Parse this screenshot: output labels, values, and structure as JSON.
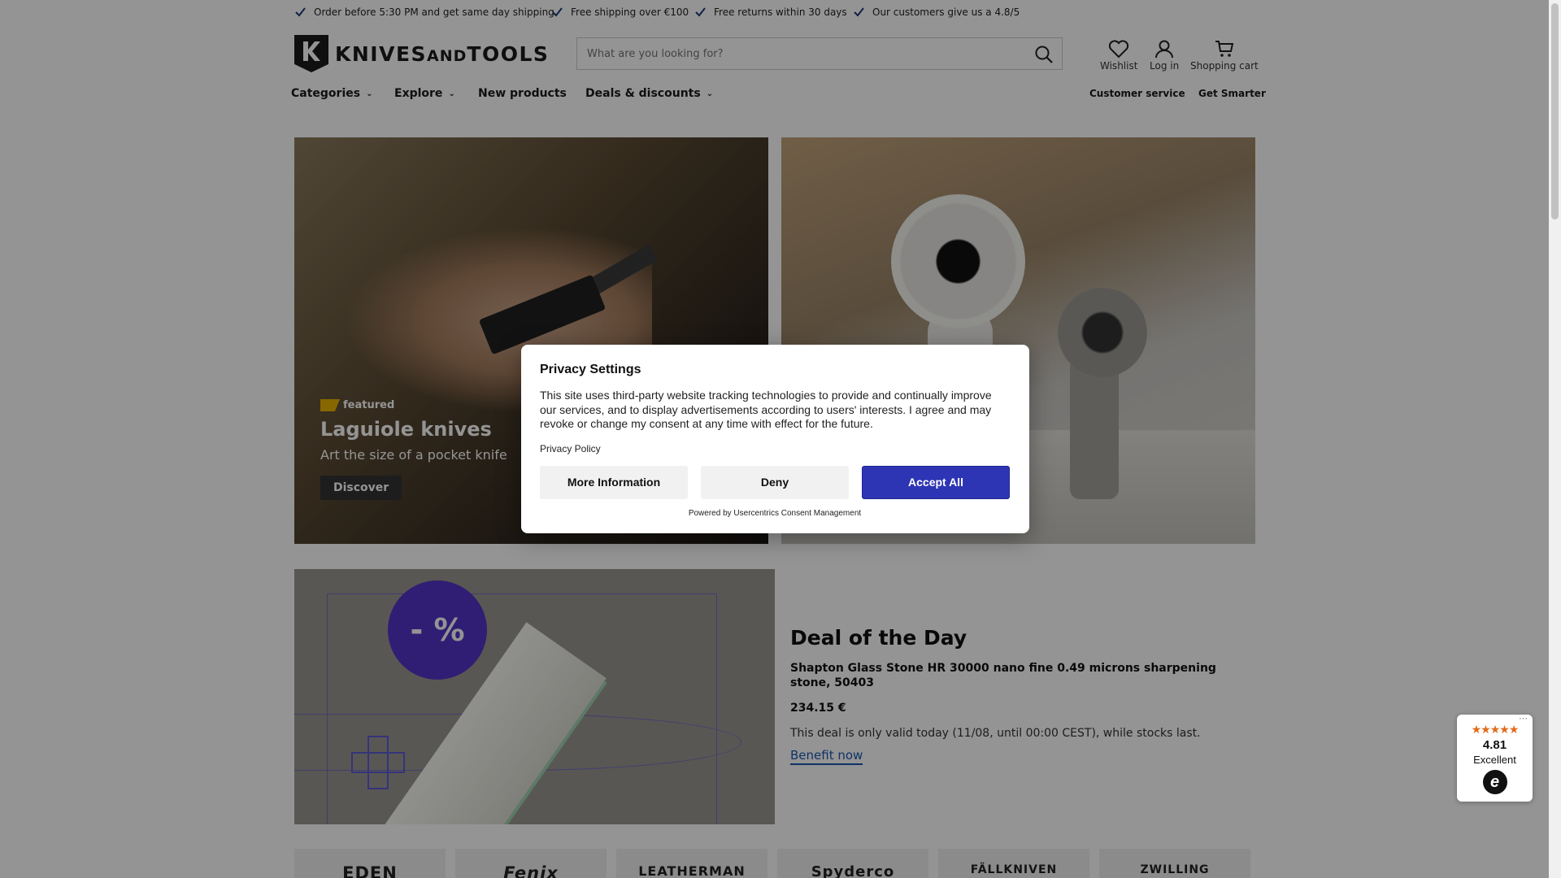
{
  "usp": [
    "Order before 5:30 PM and get same day shipping",
    "Free shipping over €100",
    "Free returns within 30 days",
    "Our customers give us a 4.8/5"
  ],
  "logo": {
    "text_main": "KNIVES",
    "text_and": "AND",
    "text_end": "TOOLS"
  },
  "search": {
    "placeholder": "What are you looking for?",
    "icon": "search-icon"
  },
  "header_icons": {
    "wishlist": "Wishlist",
    "login": "Log in",
    "cart": "Shopping cart"
  },
  "nav": {
    "categories": "Categories",
    "explore": "Explore",
    "new_products": "New products",
    "deals": "Deals & discounts",
    "customer_service": "Customer service",
    "get_smarter": "Get Smarter"
  },
  "hero": {
    "tag": "featured",
    "title": "Laguiole knives",
    "subtitle": "Art the size of a pocket knife",
    "button": "Discover"
  },
  "deal": {
    "badge": "- %",
    "title": "Deal of the Day",
    "product": "Shapton Glass Stone HR 30000 nano fine 0.49 microns sharpening stone, 50403",
    "price": "234.15 €",
    "note": "This deal is only valid today (11/08, until 00:00 CEST), while stocks last.",
    "link": "Benefit now"
  },
  "brands": [
    "EDEN",
    "Fenix",
    "LEATHERMAN",
    "Spyderco",
    "FÄLLKNIVEN",
    "ZWILLING"
  ],
  "privacy": {
    "title": "Privacy Settings",
    "body": "This site uses third-party website tracking technologies to provide and continually improve our services, and to display advertisements according to users' interests. I agree and may revoke or change my consent at any time with effect for the future.",
    "policy_link": "Privacy Policy",
    "more_info": "More Information",
    "deny": "Deny",
    "accept": "Accept All",
    "powered": "Powered by Usercentrics Consent Management"
  },
  "trust": {
    "stars": "★★★★★",
    "score": "4.81",
    "label": "Excellent",
    "logo_letter": "e",
    "menu": "···"
  },
  "colors": {
    "accent": "#2e35b5",
    "deal_badge": "#5335c9",
    "star": "#e26b1a",
    "link": "#1a56b0"
  }
}
